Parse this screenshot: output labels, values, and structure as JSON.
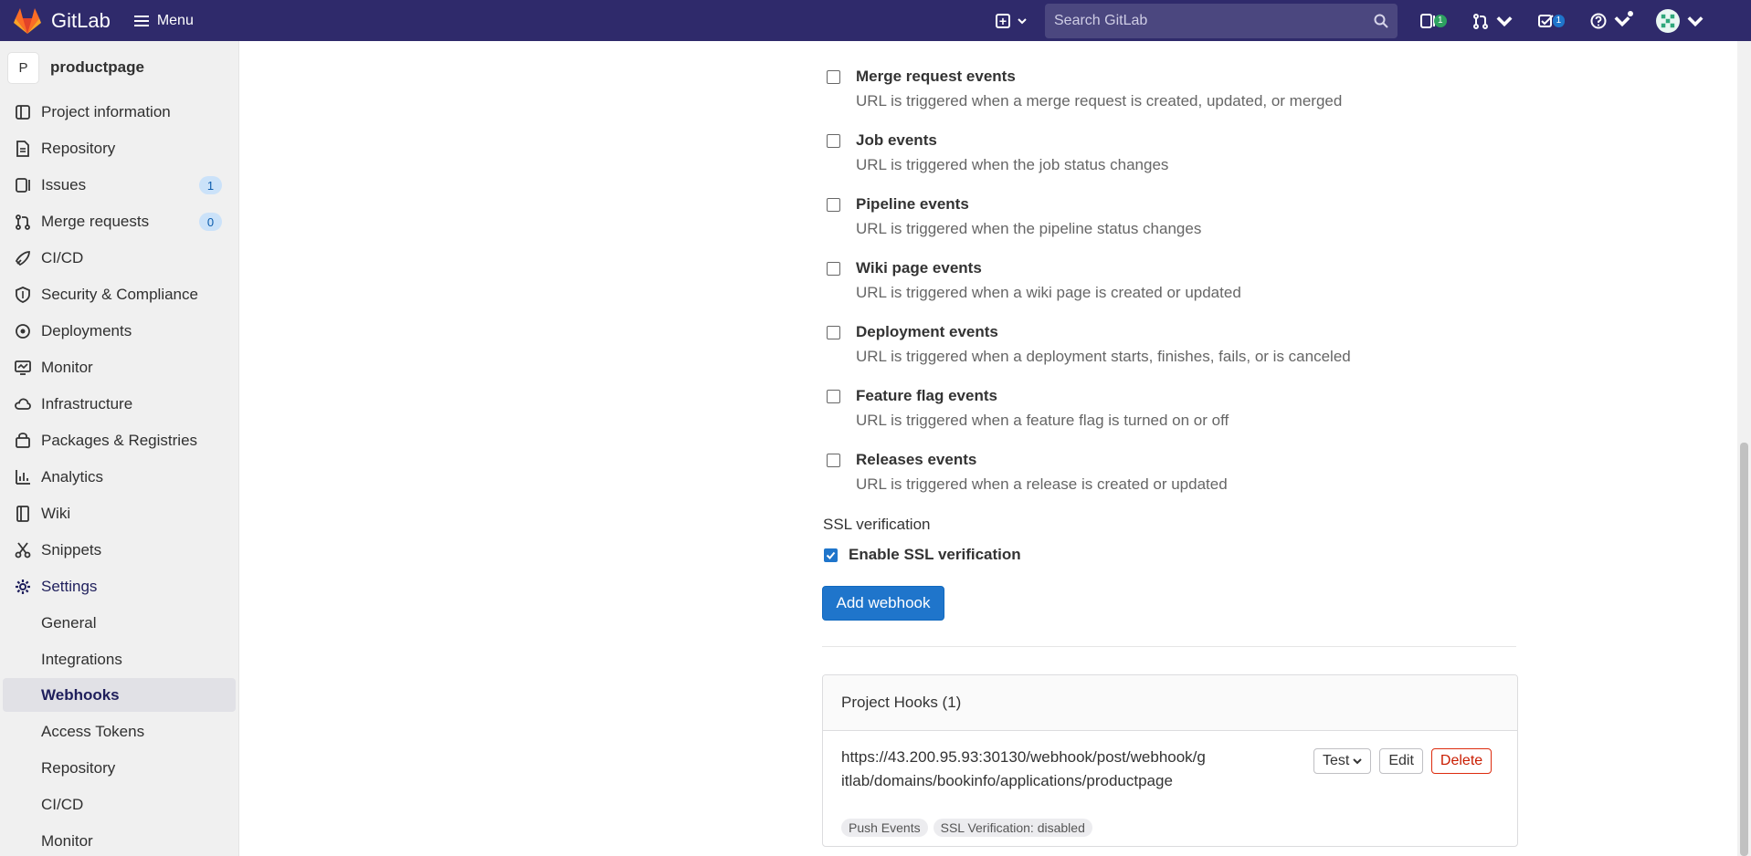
{
  "header": {
    "brand": "GitLab",
    "menu_label": "Menu",
    "search_placeholder": "Search GitLab",
    "issues_count": "1",
    "todos_count": "1"
  },
  "sidebar": {
    "project_initial": "P",
    "project_name": "productpage",
    "items": [
      {
        "label": "Project information",
        "icon": "project-icon"
      },
      {
        "label": "Repository",
        "icon": "doc-icon"
      },
      {
        "label": "Issues",
        "icon": "issues-icon",
        "count": "1"
      },
      {
        "label": "Merge requests",
        "icon": "merge-request-icon",
        "count": "0"
      },
      {
        "label": "CI/CD",
        "icon": "rocket-icon"
      },
      {
        "label": "Security & Compliance",
        "icon": "shield-icon"
      },
      {
        "label": "Deployments",
        "icon": "deployments-icon"
      },
      {
        "label": "Monitor",
        "icon": "monitor-icon"
      },
      {
        "label": "Infrastructure",
        "icon": "cloud-icon"
      },
      {
        "label": "Packages & Registries",
        "icon": "package-icon"
      },
      {
        "label": "Analytics",
        "icon": "chart-icon"
      },
      {
        "label": "Wiki",
        "icon": "book-icon"
      },
      {
        "label": "Snippets",
        "icon": "scissors-icon"
      },
      {
        "label": "Settings",
        "icon": "gear-icon"
      }
    ],
    "settings_sub": [
      {
        "label": "General"
      },
      {
        "label": "Integrations"
      },
      {
        "label": "Webhooks",
        "active": true
      },
      {
        "label": "Access Tokens"
      },
      {
        "label": "Repository"
      },
      {
        "label": "CI/CD"
      },
      {
        "label": "Monitor"
      }
    ]
  },
  "main": {
    "events": [
      {
        "title": "Merge request events",
        "desc": "URL is triggered when a merge request is created, updated, or merged"
      },
      {
        "title": "Job events",
        "desc": "URL is triggered when the job status changes"
      },
      {
        "title": "Pipeline events",
        "desc": "URL is triggered when the pipeline status changes"
      },
      {
        "title": "Wiki page events",
        "desc": "URL is triggered when a wiki page is created or updated"
      },
      {
        "title": "Deployment events",
        "desc": "URL is triggered when a deployment starts, finishes, fails, or is canceled"
      },
      {
        "title": "Feature flag events",
        "desc": "URL is triggered when a feature flag is turned on or off"
      },
      {
        "title": "Releases events",
        "desc": "URL is triggered when a release is created or updated"
      }
    ],
    "ssl_section_label": "SSL verification",
    "ssl_checkbox_label": "Enable SSL verification",
    "add_button": "Add webhook",
    "hooks": {
      "title": "Project Hooks (1)",
      "url": "https://43.200.95.93:30130/webhook/post/webhook/gitlab/domains/bookinfo/applications/productpage",
      "badges": [
        "Push Events",
        "SSL Verification: disabled"
      ],
      "test_label": "Test",
      "edit_label": "Edit",
      "delete_label": "Delete"
    }
  },
  "colors": {
    "topbar": "#2f2a6b",
    "primary": "#1f75cb",
    "danger": "#dd2b0e"
  }
}
